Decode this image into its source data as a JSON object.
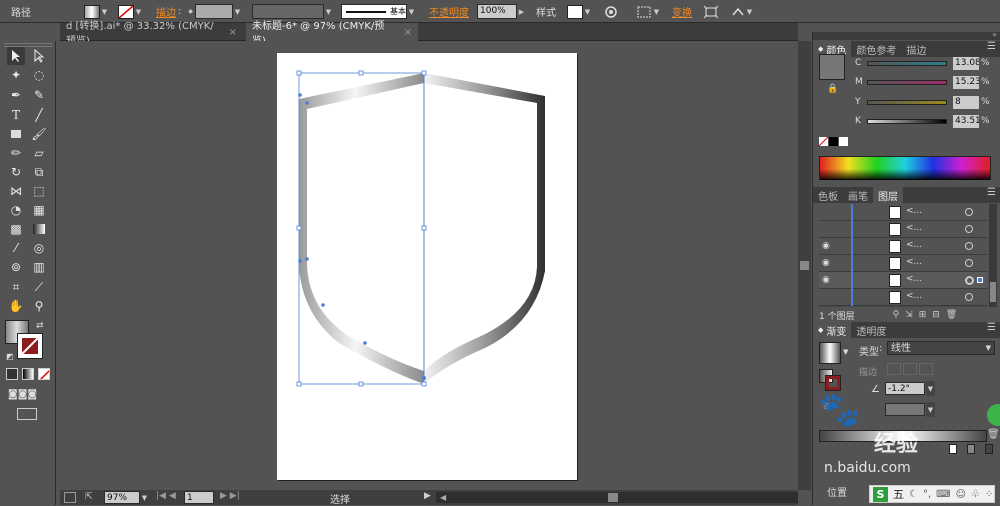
{
  "control_bar": {
    "object_type": "路径",
    "stroke_label": "描边",
    "stroke_style": "基本",
    "opacity_label": "不透明度",
    "opacity_value": "100%",
    "style_label": "样式",
    "transform_label": "变换"
  },
  "tabs": [
    {
      "label": "d [转换].ai* @ 33.32% (CMYK/预览)",
      "close": "×"
    },
    {
      "label": "未标题-6* @ 97% (CMYK/预览)",
      "close": "×"
    }
  ],
  "color_panel": {
    "tabs": [
      "颜色",
      "颜色参考",
      "描边"
    ],
    "sliders": [
      {
        "label": "C",
        "value": "13.08",
        "pct": "%"
      },
      {
        "label": "M",
        "value": "15.23",
        "pct": "%"
      },
      {
        "label": "Y",
        "value": "8",
        "pct": "%"
      },
      {
        "label": "K",
        "value": "43.51",
        "pct": "%"
      }
    ],
    "fill_color": "#777777"
  },
  "layers_panel": {
    "tabs": [
      "色板",
      "画笔",
      "图层"
    ],
    "rows": [
      {
        "name": "<...",
        "visible": false
      },
      {
        "name": "<...",
        "visible": false
      },
      {
        "name": "<...",
        "visible": true
      },
      {
        "name": "<...",
        "visible": true
      },
      {
        "name": "<...",
        "visible": true
      },
      {
        "name": "<...",
        "visible": false
      }
    ],
    "footer": "1 个图层"
  },
  "gradient_panel": {
    "tabs": [
      "渐变",
      "透明度"
    ],
    "type_label": "类型",
    "type_value": "线性",
    "stroke_label": "描边",
    "angle_value": "-1.2°",
    "location_label": "位置"
  },
  "status_bar": {
    "zoom": "97%",
    "page": "1",
    "tool": "选择"
  },
  "watermark": {
    "text": "经验",
    "url": "n.baidu.com"
  },
  "ime_bar": {
    "label": "五"
  },
  "colors": {
    "ui_bg": "#535353",
    "accent_orange": "#f08a24",
    "selection_blue": "#4a7fd8"
  }
}
